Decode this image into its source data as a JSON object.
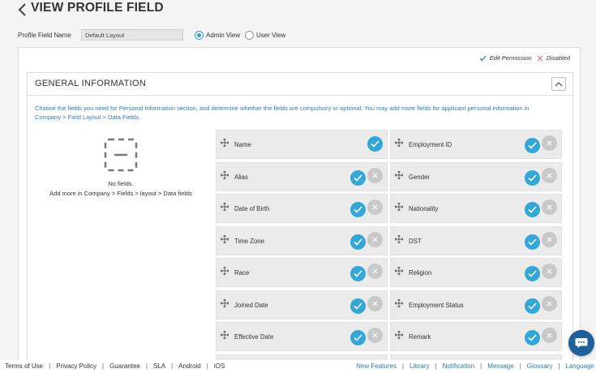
{
  "header": {
    "title": "VIEW PROFILE FIELD"
  },
  "filter": {
    "profile_field_label": "Profile Field Name",
    "profile_field_value": "Default Layout",
    "admin_view_label": "Admin View",
    "user_view_label": "User View",
    "selected_view": "Admin View"
  },
  "legend": {
    "edit_permission": "Edit Permission",
    "disabled": "Disabled"
  },
  "section": {
    "title": "GENERAL INFORMATION",
    "description": "Choose the fields you need for Personal Information section, and determine whether the fields are compulsory or optional. You may add more fields for applicant personal information in Company > Field Layout > Data Fields.",
    "empty_title": "No fields.",
    "empty_hint": "Add more in Company > Fields > layout > Data fields"
  },
  "fields": [
    {
      "name": "Name",
      "disabled_btn": false
    },
    {
      "name": "Employment ID",
      "disabled_btn": true
    },
    {
      "name": "Alias",
      "disabled_btn": true
    },
    {
      "name": "Gender",
      "disabled_btn": true
    },
    {
      "name": "Date of Birth",
      "disabled_btn": true
    },
    {
      "name": "Nationality",
      "disabled_btn": true
    },
    {
      "name": "Time Zone",
      "disabled_btn": true
    },
    {
      "name": "DST",
      "disabled_btn": true
    },
    {
      "name": "Race",
      "disabled_btn": true
    },
    {
      "name": "Religion",
      "disabled_btn": true
    },
    {
      "name": "Joined Date",
      "disabled_btn": true
    },
    {
      "name": "Employment Status",
      "disabled_btn": true
    },
    {
      "name": "Effective Date",
      "disabled_btn": true
    },
    {
      "name": "Remark",
      "disabled_btn": true
    }
  ],
  "footer": {
    "left": [
      "Terms of Use",
      "Privacy Policy",
      "Guarantee",
      "SLA",
      "Android",
      "iOS"
    ],
    "right": [
      "New Features",
      "Library",
      "Notification",
      "Message",
      "Glossary",
      "Language"
    ]
  },
  "colors": {
    "accent": "#33a8d8",
    "link": "#2b7fb0",
    "chat": "#1f5f9a",
    "disabled": "#c9c9c9"
  },
  "icons": {
    "back": "chevron-left-icon",
    "collapse": "chevron-up-icon",
    "drag": "move-icon",
    "check": "check-icon",
    "cross": "close-icon",
    "empty": "empty-box-icon",
    "chat": "chat-icon"
  }
}
